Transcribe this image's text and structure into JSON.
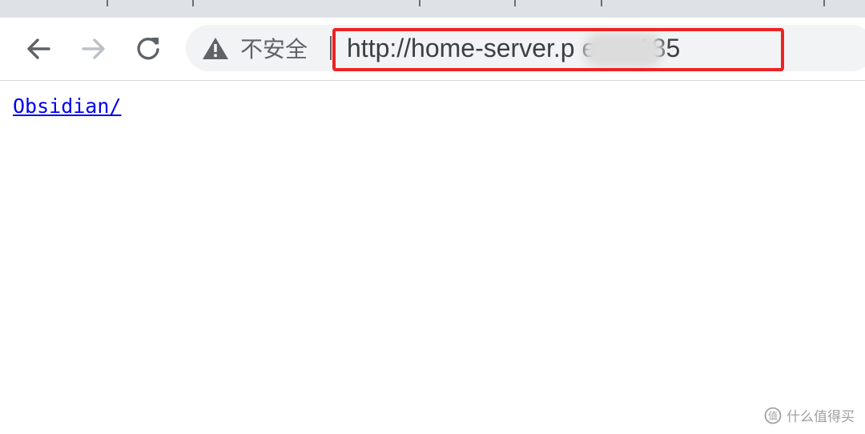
{
  "browser": {
    "security_label": "不安全",
    "url": "http://home-server.p      e.cn:185"
  },
  "page": {
    "link_text": "Obsidian/"
  },
  "watermark": {
    "text": "什么值得买"
  },
  "colors": {
    "highlight_border": "#ee2222",
    "link": "#0000ee",
    "omnibox_bg": "#f1f3f4",
    "tabstrip_bg": "#dee1e6"
  }
}
